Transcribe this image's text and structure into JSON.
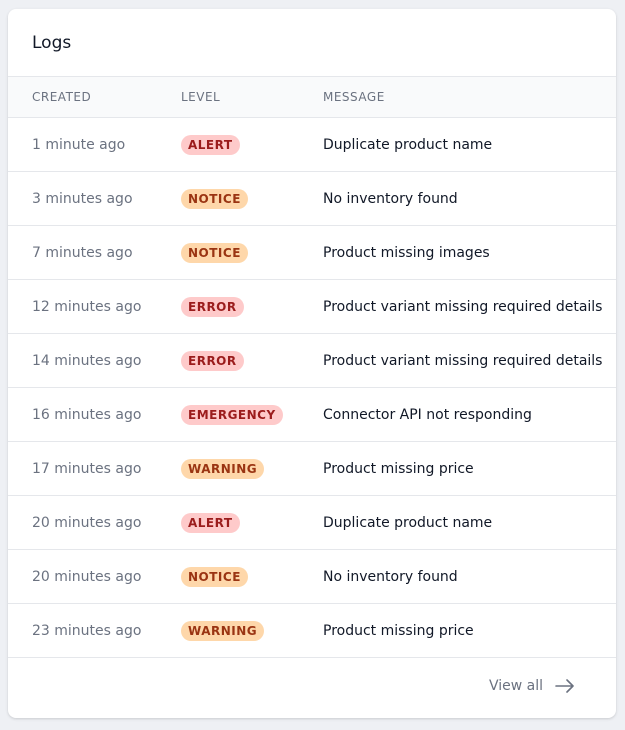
{
  "card": {
    "title": "Logs"
  },
  "table": {
    "headers": {
      "created": "CREATED",
      "level": "LEVEL",
      "message": "MESSAGE"
    },
    "rows": [
      {
        "created": "1 minute ago",
        "level": "ALERT",
        "level_color": "red",
        "message": "Duplicate product name"
      },
      {
        "created": "3 minutes ago",
        "level": "NOTICE",
        "level_color": "orange",
        "message": "No inventory found"
      },
      {
        "created": "7 minutes ago",
        "level": "NOTICE",
        "level_color": "orange",
        "message": "Product missing images"
      },
      {
        "created": "12 minutes ago",
        "level": "ERROR",
        "level_color": "red",
        "message": "Product variant missing required details"
      },
      {
        "created": "14 minutes ago",
        "level": "ERROR",
        "level_color": "red",
        "message": "Product variant missing required details"
      },
      {
        "created": "16 minutes ago",
        "level": "EMERGENCY",
        "level_color": "red",
        "message": "Connector API not responding"
      },
      {
        "created": "17 minutes ago",
        "level": "WARNING",
        "level_color": "orange",
        "message": "Product missing price"
      },
      {
        "created": "20 minutes ago",
        "level": "ALERT",
        "level_color": "red",
        "message": "Duplicate product name"
      },
      {
        "created": "20 minutes ago",
        "level": "NOTICE",
        "level_color": "orange",
        "message": "No inventory found"
      },
      {
        "created": "23 minutes ago",
        "level": "WARNING",
        "level_color": "orange",
        "message": "Product missing price"
      }
    ]
  },
  "footer": {
    "view_all_label": "View all",
    "view_all_icon": "arrow-right-icon"
  },
  "colors": {
    "badge_red_bg": "#fecaca",
    "badge_red_text": "#9b1c1c",
    "badge_orange_bg": "#fed7aa",
    "badge_orange_text": "#9a3412"
  }
}
